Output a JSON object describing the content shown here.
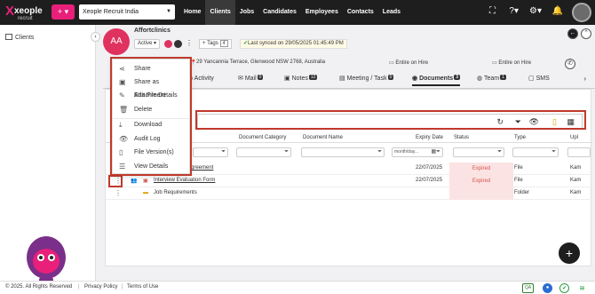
{
  "app": {
    "logo_text": "xeople",
    "logo_sub": "recruit",
    "org_selector": "Xeople Recruit India"
  },
  "nav": {
    "items": [
      "Home",
      "Clients",
      "Jobs",
      "Candidates",
      "Employees",
      "Contacts",
      "Leads"
    ],
    "active": "Clients"
  },
  "sidebar": {
    "items": [
      {
        "label": "Clients"
      }
    ]
  },
  "record": {
    "initials": "AA",
    "name": "Affortclinics",
    "status": "Active",
    "tags_label": "+ Tags",
    "tags_count": "4",
    "last_synced": "Last synced on 29/05/2025 01:45:49 PM",
    "address": "29 Yancannia Terrace, Glenwood NSW 2768, Australia",
    "entire_1": "Entire on Hire",
    "entire_2": "Entire on Hire"
  },
  "tabs": [
    {
      "label": "Activity",
      "count": ""
    },
    {
      "label": "Mail",
      "count": "0"
    },
    {
      "label": "Notes",
      "count": "12"
    },
    {
      "label": "Meeting / Task",
      "count": "0"
    },
    {
      "label": "Documents",
      "count": "3"
    },
    {
      "label": "Team",
      "count": "1"
    },
    {
      "label": "SMS",
      "count": ""
    }
  ],
  "context_menu": {
    "items": [
      {
        "label": "Share",
        "icon": "share-icon"
      },
      {
        "label": "Share as Attachment",
        "icon": "attachment-icon"
      },
      {
        "label": "Edit File Details",
        "icon": "edit-icon"
      },
      {
        "label": "Delete",
        "icon": "trash-icon"
      },
      {
        "label": "Download",
        "icon": "download-icon"
      },
      {
        "label": "Audit Log",
        "icon": "eye-icon"
      },
      {
        "label": "File Version(s)",
        "icon": "file-icon"
      },
      {
        "label": "View Details",
        "icon": "list-icon"
      }
    ]
  },
  "table": {
    "columns": [
      "Document Category",
      "Document Name",
      "Expiry Date",
      "Status",
      "Type",
      "Upl"
    ],
    "date_placeholder": "month/day...",
    "rows": [
      {
        "name": "greement",
        "expiry": "22/07/2025",
        "status": "Expired",
        "type": "File",
        "uploaded": "Kam"
      },
      {
        "name": "Interview Evaluation Form",
        "expiry": "22/07/2025",
        "status": "Expired",
        "type": "File",
        "uploaded": "Kam"
      },
      {
        "name": "Job Requirements",
        "expiry": "",
        "status": "",
        "type": "Folder",
        "uploaded": "Kam"
      }
    ]
  },
  "footer": {
    "copyright": "© 2025. All Rights Reserved",
    "privacy": "Privacy Policy",
    "terms": "Terms of Use",
    "qa_badge": "QA"
  },
  "colors": {
    "brand_pink": "#e8207a",
    "avatar_red": "#e0325f",
    "expired_bg": "#fbe3e3",
    "expired_text": "#d9534f",
    "highlight": "#c0392b"
  }
}
